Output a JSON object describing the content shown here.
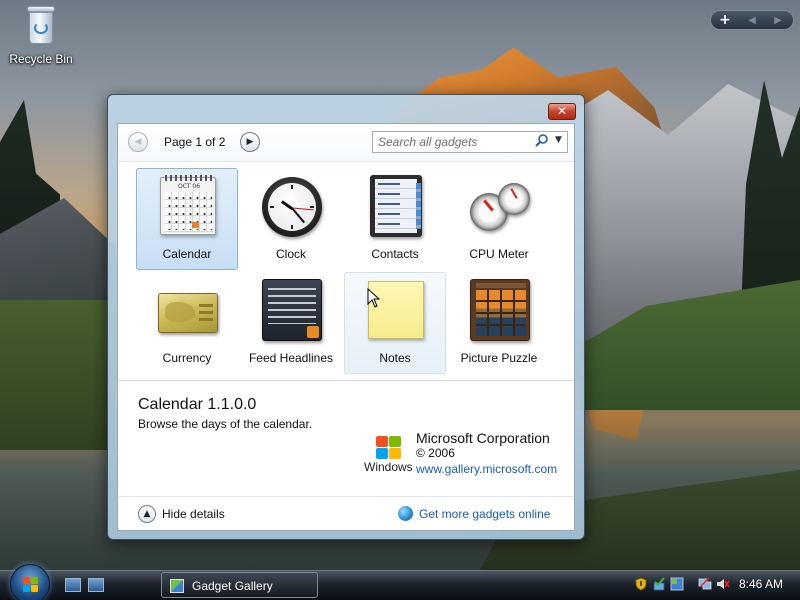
{
  "desktop": {
    "recycle_bin_label": "Recycle Bin"
  },
  "sidebar_control": {
    "add_label": "+",
    "prev_label": "◀",
    "next_label": "▶"
  },
  "gallery": {
    "close_label": "✕",
    "pagination": {
      "prev_label": "◀",
      "label": "Page 1 of 2",
      "next_label": "▶"
    },
    "search": {
      "placeholder": "Search all gadgets",
      "dropdown_label": "▼"
    },
    "gadgets": [
      {
        "name": "Calendar",
        "icon": "calendar-icon",
        "state": "selected"
      },
      {
        "name": "Clock",
        "icon": "clock-icon"
      },
      {
        "name": "Contacts",
        "icon": "contacts-icon"
      },
      {
        "name": "CPU Meter",
        "icon": "cpu-meter-icon"
      },
      {
        "name": "Currency",
        "icon": "currency-icon"
      },
      {
        "name": "Feed Headlines",
        "icon": "feed-headlines-icon"
      },
      {
        "name": "Notes",
        "icon": "notes-icon",
        "state": "hover"
      },
      {
        "name": "Picture Puzzle",
        "icon": "picture-puzzle-icon"
      }
    ],
    "calendar_icon_month": "OCT 06",
    "details": {
      "title": "Calendar 1.1.0.0",
      "description": "Browse the days of the calendar.",
      "windows_logo_text": "Windows",
      "publisher": "Microsoft Corporation",
      "copyright": "© 2006",
      "url": "www.gallery.microsoft.com"
    },
    "footer": {
      "hide_button_label": "▲",
      "hide_details_label": "Hide details",
      "get_more_label": "Get more gadgets online"
    }
  },
  "taskbar": {
    "active_window_label": "Gadget Gallery",
    "clock": "8:46 AM"
  },
  "colors": {
    "link": "#1a5bbf",
    "selection": "#c8def3",
    "close_red": "#c8432c"
  }
}
